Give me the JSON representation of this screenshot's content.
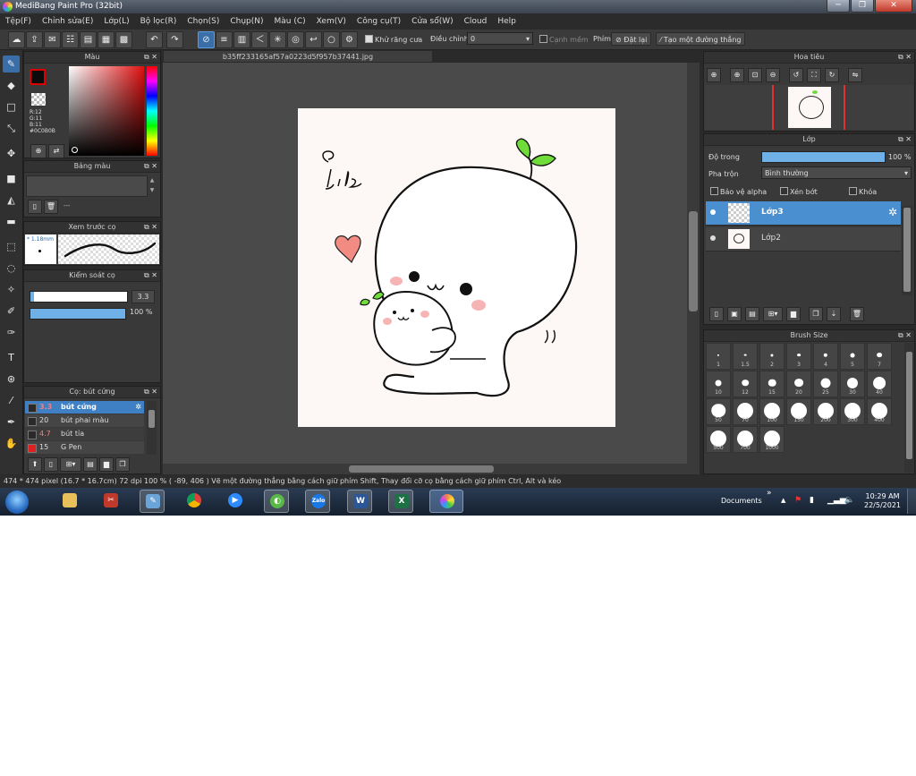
{
  "window": {
    "title": "MediBang Paint Pro (32bit)",
    "minimize": "─",
    "restore": "❐",
    "close": "✕"
  },
  "menu": [
    "Tệp(F)",
    "Chỉnh sửa(E)",
    "Lớp(L)",
    "Bộ lọc(R)",
    "Chọn(S)",
    "Chụp(N)",
    "Màu (C)",
    "Xem(V)",
    "Công cụ(T)",
    "Cửa sổ(W)",
    "Cloud",
    "Help"
  ],
  "toolbar": {
    "antialias_label": "Khử răng cưa",
    "adjust_label": "Điều chỉnh",
    "adjust_value": "0",
    "edge_label": "Cạnh mềm",
    "key_label": "Phím",
    "reset_label": "Đặt lại",
    "straight_label": "Tạo một đường thẳng"
  },
  "color_panel": {
    "title": "Màu",
    "r": "R:12",
    "g": "G:11",
    "b": "B:11",
    "hex": "#0C0B0B"
  },
  "palette_panel": {
    "title": "Bảng màu",
    "value": "---"
  },
  "brush_preview": {
    "title": "Xem trước cọ",
    "size": "1.18mm"
  },
  "brush_control": {
    "title": "Kiểm soát cọ",
    "size_value": "3.3",
    "opacity_value": "100 %",
    "opacity": 1.0,
    "size_fraction": 0.95
  },
  "brush_list": {
    "title": "Cọ: bút cứng",
    "items": [
      {
        "size": "3.3",
        "name": "bút cứng",
        "color": "#2a2a2a"
      },
      {
        "size": "20",
        "name": "bút phai màu",
        "color": "#2a2a2a"
      },
      {
        "size": "4.7",
        "name": "bút tỉa",
        "color": "#2a2a2a"
      },
      {
        "size": "15",
        "name": "G Pen",
        "color": "#e02020"
      }
    ]
  },
  "document": {
    "tab": "b35ff233165af57a0223d5f957b37441.jpg"
  },
  "navigator": {
    "title": "Hoa tiêu"
  },
  "layer_panel": {
    "title": "Lớp",
    "opacity_label": "Độ trong",
    "opacity_value": "100 %",
    "opacity": 1.0,
    "blend_label": "Pha trộn",
    "blend_value": "Bình thường",
    "protect_alpha": "Bảo vệ alpha",
    "clipping": "Xén bớt",
    "lock": "Khóa",
    "layers": [
      "Lớp3",
      "Lớp2"
    ]
  },
  "brush_size_panel": {
    "title": "Brush Size",
    "sizes": [
      "1",
      "1.5",
      "2",
      "3",
      "4",
      "5",
      "7",
      "10",
      "12",
      "15",
      "20",
      "25",
      "30",
      "40",
      "50",
      "70",
      "100",
      "150",
      "200",
      "300",
      "400",
      "500",
      "700",
      "1000"
    ]
  },
  "drawing": {
    "signature": "@ Lily"
  },
  "status": {
    "text": "474 * 474 pixel   (16.7 * 16.7cm)   72 dpi   100 %   ( -89, 406 )   Vẽ một đường thẳng bằng cách giữ phím Shift, Thay đổi cỡ cọ bằng cách giữ phím Ctrl, Alt và kéo"
  },
  "taskbar": {
    "documents_label": "Documents",
    "chevron": "»",
    "time": "10:29 AM",
    "date": "22/5/2021",
    "zalo_label": "Zalo",
    "word_label": "W",
    "excel_label": "X"
  }
}
